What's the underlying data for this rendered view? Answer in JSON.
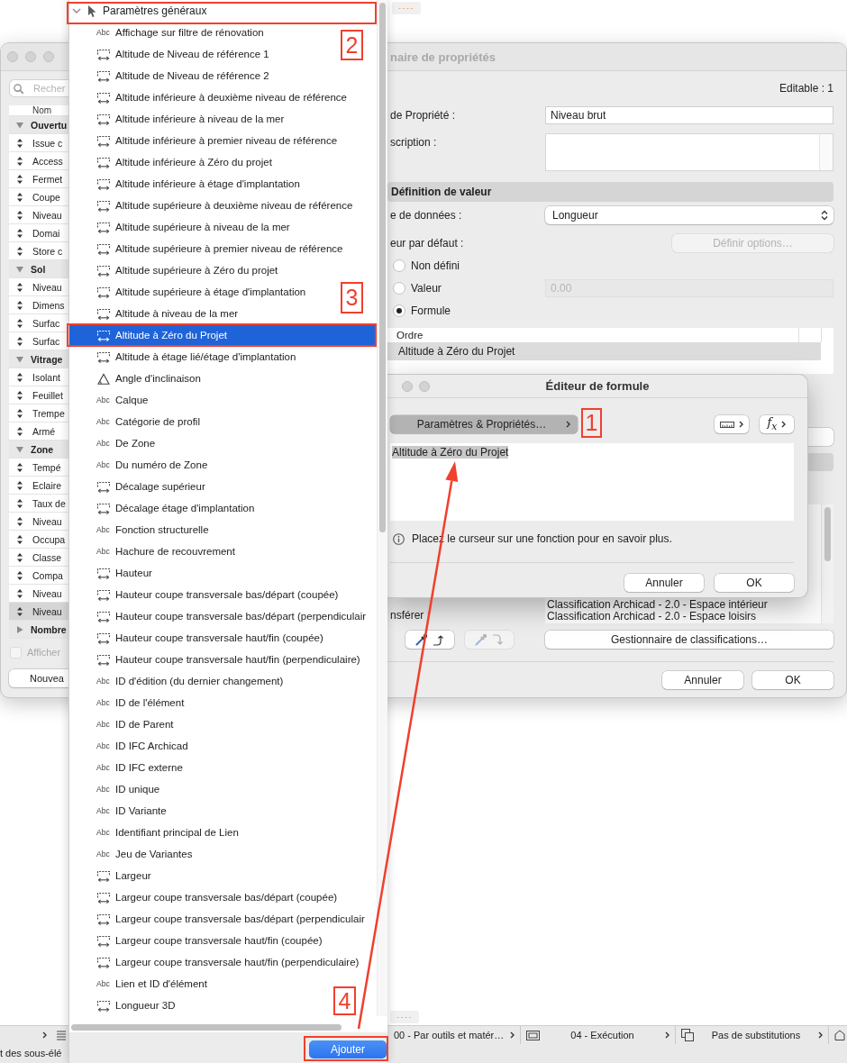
{
  "desktop": {
    "top_chip": "----",
    "bottom_chip": "----"
  },
  "properties_window": {
    "title": "naire de propriétés",
    "search": {
      "placeholder": "Recher"
    },
    "list": {
      "column": "Nom",
      "groups": [
        {
          "name": "Ouvertu",
          "expanded": true,
          "items": [
            {
              "name": "Issue c",
              "selected": false
            },
            {
              "name": "Access",
              "selected": false
            },
            {
              "name": "Fermet",
              "selected": false
            },
            {
              "name": "Coupe",
              "selected": false
            },
            {
              "name": "Niveau",
              "selected": false
            },
            {
              "name": "Domai",
              "selected": false
            },
            {
              "name": "Store c",
              "selected": false
            }
          ]
        },
        {
          "name": "Sol",
          "expanded": true,
          "items": [
            {
              "name": "Niveau",
              "selected": false
            },
            {
              "name": "Dimens",
              "selected": false
            },
            {
              "name": "Surfac",
              "selected": false
            },
            {
              "name": "Surfac",
              "selected": false
            }
          ]
        },
        {
          "name": "Vitrage",
          "expanded": true,
          "items": [
            {
              "name": "Isolant",
              "selected": false
            },
            {
              "name": "Feuillet",
              "selected": false
            },
            {
              "name": "Trempe",
              "selected": false
            },
            {
              "name": "Armé",
              "selected": false
            }
          ]
        },
        {
          "name": "Zone",
          "expanded": true,
          "items": [
            {
              "name": "Tempé",
              "selected": false
            },
            {
              "name": "Eclaire",
              "selected": false
            },
            {
              "name": "Taux de",
              "selected": false
            },
            {
              "name": "Niveau",
              "selected": false
            },
            {
              "name": "Occupa",
              "selected": false
            },
            {
              "name": "Classe",
              "selected": false
            },
            {
              "name": "Compa",
              "selected": false
            },
            {
              "name": "Niveau",
              "selected": false
            },
            {
              "name": "Niveau",
              "selected": true
            }
          ]
        },
        {
          "name": "Nombre",
          "expanded": false
        }
      ]
    },
    "show_checkbox": {
      "label": "Afficher",
      "checked": false,
      "disabled": true
    },
    "new_button": {
      "label": "Nouvea"
    },
    "editable": "Editable : 1",
    "name_field": {
      "label": "de Propriété :",
      "value": "Niveau brut"
    },
    "description_field": {
      "label": "scription :"
    },
    "section_title": "Définition de valeur",
    "data_type": {
      "label": "e de données :",
      "value": "Longueur"
    },
    "default_value": {
      "label": "eur par défaut :",
      "options_button": {
        "label": "Définir options…",
        "disabled": true
      }
    },
    "default_modes": [
      {
        "label": "Non défini",
        "selected": false
      },
      {
        "label": "Valeur",
        "selected": false
      },
      {
        "label": "Formule",
        "selected": true
      }
    ],
    "value_field": {
      "value": "0.00",
      "disabled": true
    },
    "order_table": {
      "column": "Ordre",
      "rows": [
        {
          "text": "Altitude à Zéro du Projet",
          "selected": true
        }
      ]
    },
    "classifications": [
      "Classification Archicad - 2.0 - Espace intérieur",
      "Classification Archicad - 2.0 - Espace loisirs"
    ],
    "transfer": {
      "label": "nsférer :",
      "buttons": [
        {
          "kind": "pick",
          "disabled": false
        },
        {
          "kind": "inject",
          "disabled": true
        }
      ]
    },
    "classification_button": {
      "label": "Gestionnaire de classifications…"
    },
    "buttons": [
      {
        "label": "Annuler"
      },
      {
        "label": "OK"
      }
    ]
  },
  "formula_editor": {
    "title": "Éditeur de formule",
    "params_button": {
      "label": "Paramètres & Propriétés…",
      "pressed": true
    },
    "function_button": {
      "label": "f$_{x}$"
    },
    "formula": {
      "value": "Altitude à Zéro du Projet",
      "selected": true
    },
    "hint": "Placez le curseur sur une fonction pour en savoir plus.",
    "buttons": [
      {
        "label": "Annuler"
      },
      {
        "label": "OK"
      }
    ]
  },
  "parameter_popup": {
    "header": {
      "label": "Paramètres généraux",
      "expanded": true
    },
    "items": [
      {
        "kind": "text",
        "badge": "Abc",
        "label": "Affichage sur filtre de rénovation",
        "selected": false
      },
      {
        "kind": "length",
        "label": "Altitude de Niveau de référence 1",
        "selected": false
      },
      {
        "kind": "length",
        "label": "Altitude de Niveau de référence 2",
        "selected": false
      },
      {
        "kind": "length",
        "label": "Altitude inférieure à deuxième niveau de référence",
        "selected": false
      },
      {
        "kind": "length",
        "label": "Altitude inférieure à niveau de la mer",
        "selected": false
      },
      {
        "kind": "length",
        "label": "Altitude inférieure à premier niveau de référence",
        "selected": false
      },
      {
        "kind": "length",
        "label": "Altitude inférieure à Zéro du projet",
        "selected": false
      },
      {
        "kind": "length",
        "label": "Altitude inférieure à étage d'implantation",
        "selected": false
      },
      {
        "kind": "length",
        "label": "Altitude supérieure à deuxième niveau de référence",
        "selected": false
      },
      {
        "kind": "length",
        "label": "Altitude supérieure à niveau de la mer",
        "selected": false
      },
      {
        "kind": "length",
        "label": "Altitude supérieure à premier niveau de référence",
        "selected": false
      },
      {
        "kind": "length",
        "label": "Altitude supérieure à Zéro du projet",
        "selected": false
      },
      {
        "kind": "length",
        "label": "Altitude supérieure à étage d'implantation",
        "selected": false
      },
      {
        "kind": "length",
        "label": "Altitude à niveau de la mer",
        "selected": false
      },
      {
        "kind": "length",
        "label": "Altitude à Zéro du Projet",
        "selected": true
      },
      {
        "kind": "length",
        "label": "Altitude à étage lié/étage d'implantation",
        "selected": false
      },
      {
        "kind": "angle",
        "label": "Angle d'inclinaison",
        "selected": false
      },
      {
        "kind": "text",
        "badge": "Abc",
        "label": "Calque",
        "selected": false
      },
      {
        "kind": "text",
        "badge": "Abc",
        "label": "Catégorie de profil",
        "selected": false
      },
      {
        "kind": "text",
        "badge": "Abc",
        "label": "De Zone",
        "selected": false
      },
      {
        "kind": "text",
        "badge": "Abc",
        "label": "Du numéro de Zone",
        "selected": false
      },
      {
        "kind": "length",
        "label": "Décalage supérieur",
        "selected": false
      },
      {
        "kind": "length",
        "label": "Décalage étage d'implantation",
        "selected": false
      },
      {
        "kind": "text",
        "badge": "Abc",
        "label": "Fonction structurelle",
        "selected": false
      },
      {
        "kind": "text",
        "badge": "Abc",
        "label": "Hachure de recouvrement",
        "selected": false
      },
      {
        "kind": "length",
        "label": "Hauteur",
        "selected": false
      },
      {
        "kind": "length",
        "label": "Hauteur coupe transversale bas/départ (coupée)",
        "selected": false
      },
      {
        "kind": "length",
        "label": "Hauteur coupe transversale bas/départ (perpendiculair",
        "selected": false
      },
      {
        "kind": "length",
        "label": "Hauteur coupe transversale haut/fin (coupée)",
        "selected": false
      },
      {
        "kind": "length",
        "label": "Hauteur coupe transversale haut/fin (perpendiculaire)",
        "selected": false
      },
      {
        "kind": "text",
        "badge": "Abc",
        "label": "ID d'édition (du dernier changement)",
        "selected": false
      },
      {
        "kind": "text",
        "badge": "Abc",
        "label": "ID de l'élément",
        "selected": false
      },
      {
        "kind": "text",
        "badge": "Abc",
        "label": "ID de Parent",
        "selected": false
      },
      {
        "kind": "text",
        "badge": "Abc",
        "label": "ID IFC Archicad",
        "selected": false
      },
      {
        "kind": "text",
        "badge": "Abc",
        "label": "ID IFC externe",
        "selected": false
      },
      {
        "kind": "text",
        "badge": "Abc",
        "label": "ID unique",
        "selected": false
      },
      {
        "kind": "text",
        "badge": "Abc",
        "label": "ID Variante",
        "selected": false
      },
      {
        "kind": "text",
        "badge": "Abc",
        "label": "Identifiant principal de Lien",
        "selected": false
      },
      {
        "kind": "text",
        "badge": "Abc",
        "label": "Jeu de Variantes",
        "selected": false
      },
      {
        "kind": "length",
        "label": "Largeur",
        "selected": false
      },
      {
        "kind": "length",
        "label": "Largeur coupe transversale bas/départ (coupée)",
        "selected": false
      },
      {
        "kind": "length",
        "label": "Largeur coupe transversale bas/départ (perpendiculair",
        "selected": false
      },
      {
        "kind": "length",
        "label": "Largeur coupe transversale haut/fin (coupée)",
        "selected": false
      },
      {
        "kind": "length",
        "label": "Largeur coupe transversale haut/fin (perpendiculaire)",
        "selected": false
      },
      {
        "kind": "text",
        "badge": "Abc",
        "label": "Lien et ID d'élément",
        "selected": false
      },
      {
        "kind": "length",
        "label": "Longueur 3D",
        "selected": false
      }
    ],
    "add_button": {
      "label": "Ajouter"
    }
  },
  "status_bar": {
    "segments": [
      {
        "kind": "plain",
        "label": "00 - Par outils et matér…"
      },
      {
        "kind": "view",
        "label": "04 - Exécution"
      },
      {
        "kind": "override",
        "label": "Pas de substitutions"
      }
    ],
    "note": "t des sous-élé"
  },
  "annotations": [
    {
      "label": "1"
    },
    {
      "label": "2"
    },
    {
      "label": "3"
    },
    {
      "label": "4"
    }
  ]
}
